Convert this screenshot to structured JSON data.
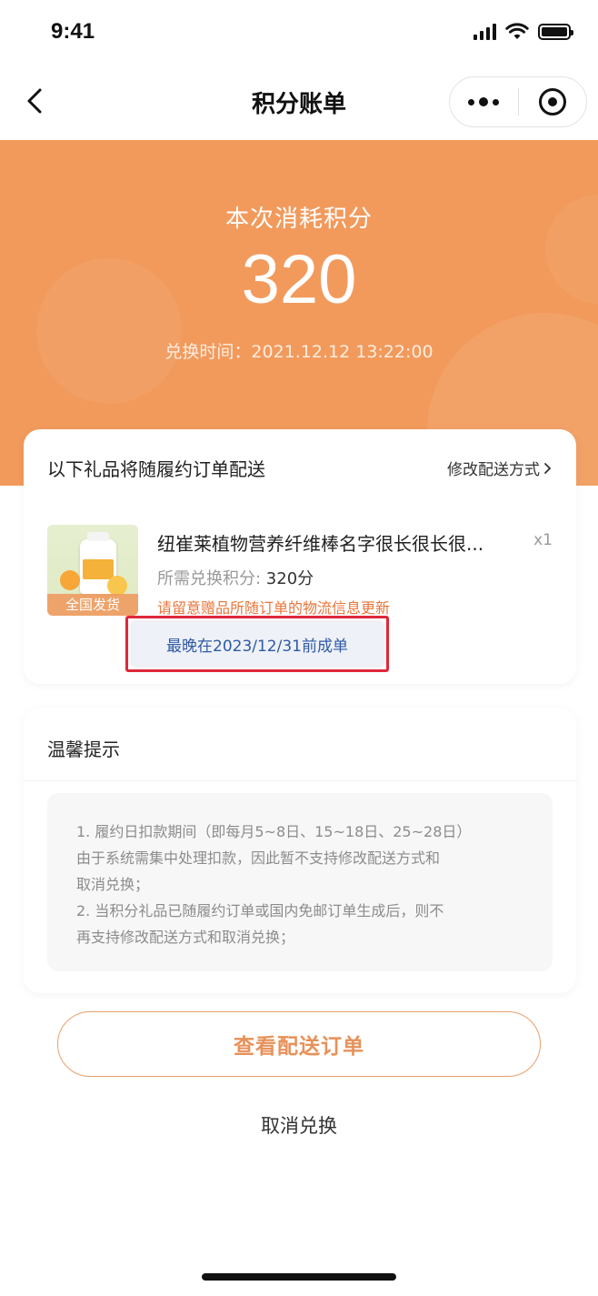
{
  "status_bar": {
    "time": "9:41",
    "icons": [
      "signal-icon",
      "wifi-icon",
      "battery-icon"
    ]
  },
  "nav": {
    "title": "积分账单",
    "back_icon": "chevron-left-icon",
    "menu_icon": "more-dots-icon",
    "close_icon": "target-icon"
  },
  "hero": {
    "label": "本次消耗积分",
    "points": "320",
    "exchange_time": "兑换时间：2021.12.12 13:22:00",
    "bg_color": "#f29a5c"
  },
  "delivery": {
    "title": "以下礼品将随履约订单配送",
    "change_link": "修改配送方式",
    "product": {
      "tag": "全国发货",
      "name": "纽崔莱植物营养纤维棒名字很长很长很...",
      "quantity": "x1",
      "points_label": "所需兑换积分: ",
      "points_value": "320分",
      "notice": "请留意赠品所随订单的物流信息更新",
      "deadline": "最晚在2023/12/31前成单"
    }
  },
  "tips": {
    "title": "温馨提示",
    "lines": [
      "1. 履约日扣款期间（即每月5~8日、15~18日、25~28日）",
      "由于系统需集中处理扣款，因此暂不支持修改配送方式和",
      "取消兑换；",
      "2. 当积分礼品已随履约订单或国内免邮订单生成后，则不",
      "再支持修改配送方式和取消兑换；"
    ]
  },
  "actions": {
    "view_orders": "查看配送订单",
    "cancel_exchange": "取消兑换"
  },
  "colors": {
    "accent": "#e7915a",
    "highlight_border": "#e0283b",
    "deadline_text": "#2f5aa5"
  }
}
